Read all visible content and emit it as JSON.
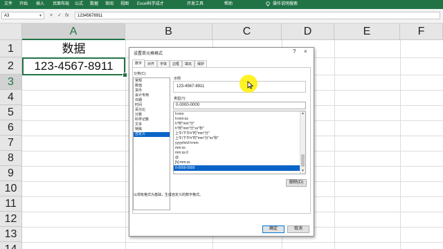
{
  "ribbon": {
    "tabs": [
      "文件",
      "开始",
      "插入",
      "页面布局",
      "公式",
      "数据",
      "审阅",
      "视图",
      "Excel科学成才",
      "开发工具",
      "帮助",
      "操作说明搜索"
    ]
  },
  "formula_bar": {
    "name_box": "A3",
    "cancel_glyph": "×",
    "enter_glyph": "✓",
    "fx_label": "fx",
    "formula": "12345678911"
  },
  "sheet": {
    "columns": [
      "A",
      "B",
      "C",
      "D",
      "E",
      "F"
    ],
    "rows": [
      "1",
      "2",
      "3",
      "4",
      "5",
      "6",
      "7",
      "8",
      "9",
      "10",
      "11",
      "12",
      "13",
      "14"
    ],
    "cells": {
      "a1": "数据",
      "a2": "123-4567-8911"
    }
  },
  "dialog": {
    "title": "设置单元格格式",
    "help": "?",
    "close": "×",
    "tabs": [
      "数字",
      "对齐",
      "字体",
      "边框",
      "填充",
      "保护"
    ],
    "category_label": "分类(C):",
    "categories": [
      "常规",
      "数值",
      "货币",
      "会计专用",
      "日期",
      "时间",
      "百分比",
      "分数",
      "科学记数",
      "文本",
      "特殊",
      "自定义"
    ],
    "selected_category": "自定义",
    "sample_label": "示例",
    "sample_value": "123-4567-8911",
    "type_label": "类型(T):",
    "type_value": "0-0000-0000",
    "formats": [
      "h:mm",
      "h:mm:ss",
      "h\"时\"mm\"分\"",
      "h\"时\"mm\"分\"ss\"秒\"",
      "上午/下午h\"时\"mm\"分\"",
      "上午/下午h\"时\"mm\"分\"ss\"秒\"",
      "yyyy/m/d h:mm",
      "mm:ss",
      "mm:ss.0",
      "@",
      "[h]:mm:ss",
      "0-0000-0000"
    ],
    "selected_format": "0-0000-0000",
    "delete_button": "删除(D)",
    "description": "以现有格式为基础，生成自定义的数字格式。",
    "ok_button": "确定",
    "cancel_button": "取消"
  },
  "colors": {
    "ribbon": "#217346",
    "selection": "#0a64c8",
    "cursor_highlight": "#fff000"
  }
}
